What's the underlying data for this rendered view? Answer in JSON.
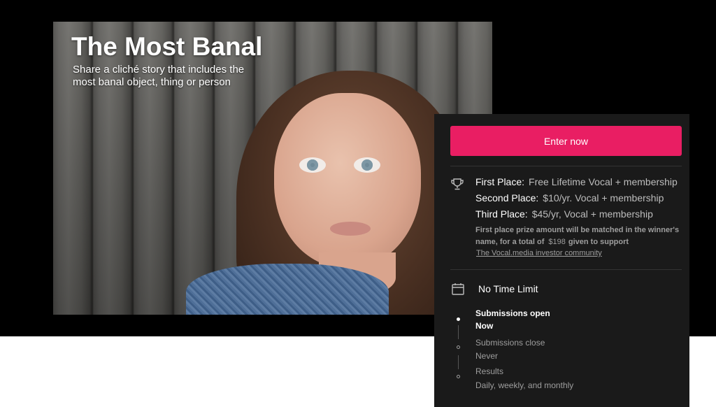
{
  "hero": {
    "title": "The Most Banal",
    "subtitle": "Share a cliché story that includes the most banal object, thing or person"
  },
  "panel": {
    "enter_label": "Enter now",
    "prizes": [
      {
        "label": "First Place:",
        "value": "Free Lifetime Vocal + membership"
      },
      {
        "label": "Second Place:",
        "value": "$10/yr. Vocal + membership"
      },
      {
        "label": "Third Place:",
        "value": "$45/yr, Vocal + membership"
      }
    ],
    "prize_note_1": "First place prize amount will be matched in the winner's name, for a total of",
    "prize_amount": "$198",
    "prize_note_2": "given to support",
    "investor_link": "The Vocal.media investor community",
    "time_limit": "No Time Limit",
    "timeline": [
      {
        "label": "Submissions open",
        "value": "Now",
        "active": true
      },
      {
        "label": "Submissions close",
        "value": "Never",
        "active": false
      },
      {
        "label": "Results",
        "value": "Daily, weekly, and monthly",
        "active": false
      }
    ]
  },
  "colors": {
    "accent": "#e91e63",
    "panel_bg": "#1a1a1a",
    "hero_band": "#000000"
  },
  "icons": {
    "prizes": "trophy-icon",
    "deadline": "calendar-icon"
  }
}
